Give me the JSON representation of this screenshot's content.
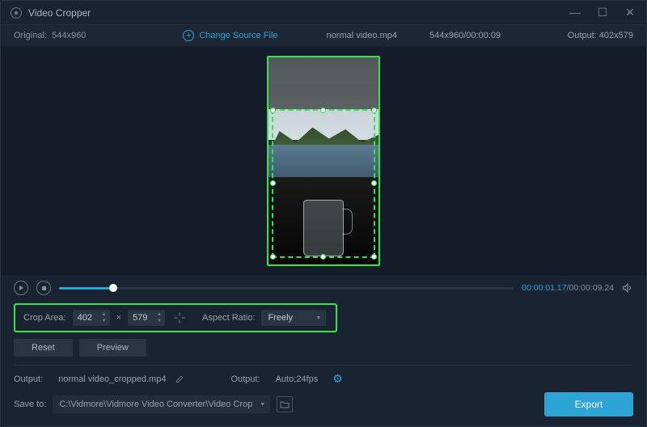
{
  "titlebar": {
    "title": "Video Cropper"
  },
  "infobar": {
    "original_label": "Original:",
    "original_dims": "544x960",
    "change_source": "Change Source File",
    "filename": "normal video.mp4",
    "dims_time": "544x960/00:00:09",
    "output_label": "Output:",
    "output_dims": "402x579"
  },
  "playback": {
    "current": "00:00:01.17",
    "total": "00:00:09.24"
  },
  "crop": {
    "area_label": "Crop Area:",
    "width": "402",
    "height": "579",
    "multiply": "×",
    "aspect_label": "Aspect Ratio:",
    "aspect_value": "Freely"
  },
  "buttons": {
    "reset": "Reset",
    "preview": "Preview",
    "export": "Export"
  },
  "output": {
    "output_label": "Output:",
    "output_filename": "normal video_cropped.mp4",
    "settings_label": "Output:",
    "settings_value": "Auto;24fps"
  },
  "save": {
    "label": "Save to:",
    "path": "C:\\Vidmore\\Vidmore Video Converter\\Video Crop"
  }
}
